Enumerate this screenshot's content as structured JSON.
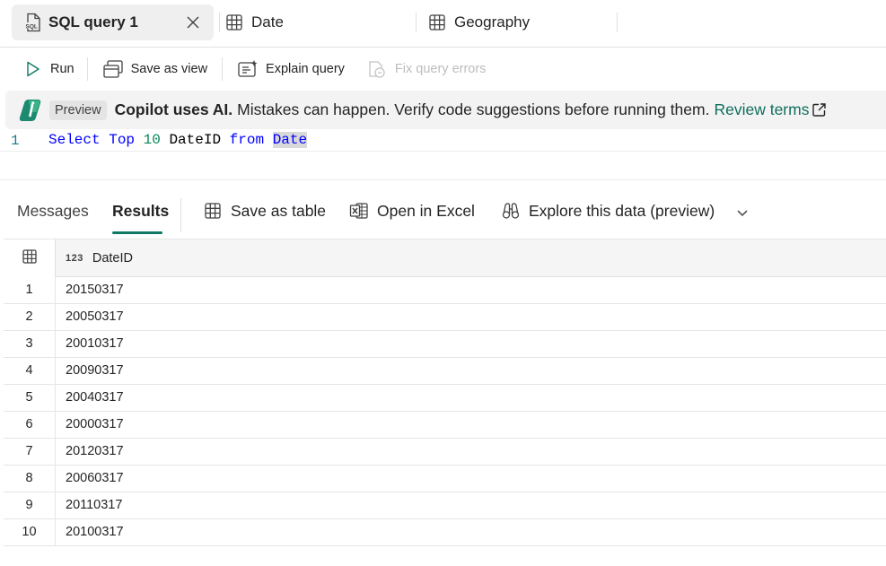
{
  "tabs": [
    {
      "label": "SQL query 1",
      "active": true,
      "icon": "sql-file-icon"
    },
    {
      "label": "Date",
      "active": false,
      "icon": "table-icon"
    },
    {
      "label": "Geography",
      "active": false,
      "icon": "table-icon"
    }
  ],
  "toolbar": {
    "run": "Run",
    "save_as_view": "Save as view",
    "explain_query": "Explain query",
    "fix_query_errors": "Fix query errors"
  },
  "banner": {
    "badge": "Preview",
    "bold": "Copilot uses AI.",
    "message": "Mistakes can happen. Verify code suggestions before running them.",
    "link": "Review terms"
  },
  "editor": {
    "line_number": "1",
    "tokens": {
      "select": "Select",
      "top": "Top",
      "count": "10",
      "column": "DateID",
      "from": "from",
      "table": "Date"
    }
  },
  "results": {
    "tabs": {
      "messages": "Messages",
      "results": "Results"
    },
    "active_tab": "Results",
    "actions": {
      "save_as_table": "Save as table",
      "open_in_excel": "Open in Excel",
      "explore_data": "Explore this data (preview)"
    },
    "columns": [
      {
        "type": "123",
        "name": "DateID"
      }
    ],
    "rows": [
      {
        "n": "1",
        "value": "20150317"
      },
      {
        "n": "2",
        "value": "20050317"
      },
      {
        "n": "3",
        "value": "20010317"
      },
      {
        "n": "4",
        "value": "20090317"
      },
      {
        "n": "5",
        "value": "20040317"
      },
      {
        "n": "6",
        "value": "20000317"
      },
      {
        "n": "7",
        "value": "20120317"
      },
      {
        "n": "8",
        "value": "20060317"
      },
      {
        "n": "9",
        "value": "20110317"
      },
      {
        "n": "10",
        "value": "20100317"
      }
    ]
  },
  "colors": {
    "accent": "#117865",
    "link": "#0f6e5e",
    "keyword": "#0000ff",
    "number": "#098658",
    "run_icon": "#117865"
  }
}
